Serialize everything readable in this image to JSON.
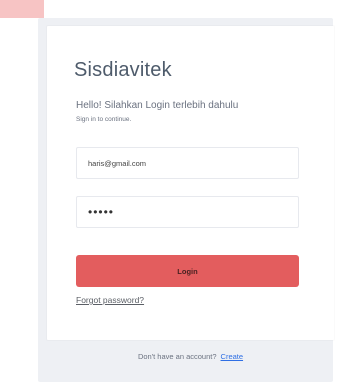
{
  "corner_tag": "",
  "login": {
    "brand": "Sisdiavitek",
    "subtitle": "Hello! Silahkan Login terlebih dahulu",
    "helper": "Sign in to continue.",
    "email_value": "haris@gmail.com",
    "password_value": "•••••",
    "login_button": "Login",
    "forgot_password": "Forgot password?",
    "footer_text": "Don't have an account?",
    "create_link": "Create"
  }
}
